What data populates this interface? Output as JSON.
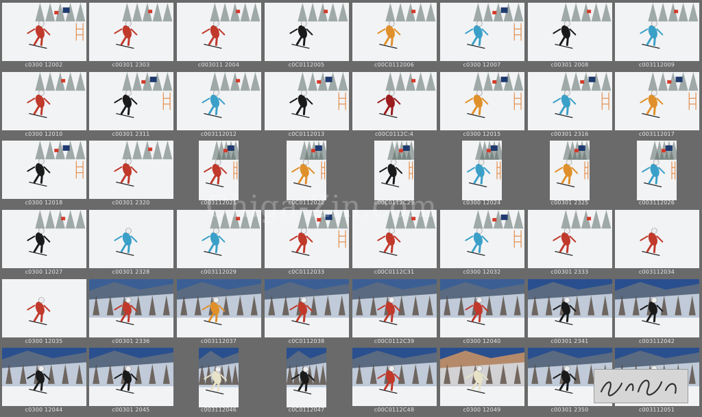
{
  "watermark": "Chiga-Zin.com",
  "signature": "Zin Shiga",
  "rows": [
    [
      {
        "caption": "c0300 12002",
        "scene": "snow-gates",
        "skier": "#c0392b"
      },
      {
        "caption": "c00301 2303",
        "scene": "snow-trees",
        "skier": "#c0392b"
      },
      {
        "caption": "c003011 2004",
        "scene": "snow-trees",
        "skier": "#c0392b"
      },
      {
        "caption": "c0C0112005",
        "scene": "snow-trees",
        "skier": "#1a1a1a"
      },
      {
        "caption": "c00C0112006",
        "scene": "snow-trees",
        "skier": "#e0902a"
      },
      {
        "caption": "c0300 12007",
        "scene": "snow-gates",
        "skier": "#3aa0c8"
      },
      {
        "caption": "c00301 2008",
        "scene": "snow-trees",
        "skier": "#1a1a1a"
      },
      {
        "caption": "c003112009",
        "scene": "snow-trees",
        "skier": "#3aa0c8"
      }
    ],
    [
      {
        "caption": "c0300 12010",
        "scene": "snow-trees",
        "skier": "#c0392b"
      },
      {
        "caption": "c00301 2311",
        "scene": "snow-gates",
        "skier": "#1a1a1a"
      },
      {
        "caption": "c003112012",
        "scene": "snow-trees",
        "skier": "#3aa0c8"
      },
      {
        "caption": "c0C0112013",
        "scene": "snow-gates",
        "skier": "#1a1a1a"
      },
      {
        "caption": "c00C0112C:4",
        "scene": "snow-trees",
        "skier": "#9b1d1d"
      },
      {
        "caption": "c0300 12015",
        "scene": "snow-gates",
        "skier": "#e0902a"
      },
      {
        "caption": "c00301 2316",
        "scene": "snow-gates",
        "skier": "#3aa0c8"
      },
      {
        "caption": "c003112017",
        "scene": "snow-gates",
        "skier": "#e0902a"
      }
    ],
    [
      {
        "caption": "c0300 12018",
        "scene": "snow-gates",
        "skier": "#1a1a1a"
      },
      {
        "caption": "c00301 2320",
        "scene": "snow-trees",
        "skier": "#c0392b"
      },
      {
        "caption": "c003112021",
        "scene": "snow-port",
        "skier": "#c0392b"
      },
      {
        "caption": "c0C0112022",
        "scene": "snow-port",
        "skier": "#e0902a"
      },
      {
        "caption": "c00C0112C23",
        "scene": "snow-port",
        "skier": "#1a1a1a"
      },
      {
        "caption": "c0300 12024",
        "scene": "snow-port",
        "skier": "#3aa0c8"
      },
      {
        "caption": "c00301 2325",
        "scene": "snow-port",
        "skier": "#e0902a"
      },
      {
        "caption": "c003112026",
        "scene": "snow-port",
        "skier": "#3aa0c8"
      }
    ],
    [
      {
        "caption": "c0300 12027",
        "scene": "snow-trees",
        "skier": "#1a1a1a"
      },
      {
        "caption": "c00301 2328",
        "scene": "snow-open",
        "skier": "#3aa0c8"
      },
      {
        "caption": "c003112029",
        "scene": "snow-trees",
        "skier": "#3aa0c8"
      },
      {
        "caption": "c0C0112033",
        "scene": "snow-gates",
        "skier": "#c0392b"
      },
      {
        "caption": "c00C0112C31",
        "scene": "snow-trees",
        "skier": "#c0392b"
      },
      {
        "caption": "c0300 12032",
        "scene": "snow-gates",
        "skier": "#3aa0c8"
      },
      {
        "caption": "c00301 2333",
        "scene": "snow-trees",
        "skier": "#c0392b"
      },
      {
        "caption": "c003112034",
        "scene": "snow-open",
        "skier": "#c0392b"
      }
    ],
    [
      {
        "caption": "c0300 12035",
        "scene": "snow-open",
        "skier": "#c0392b"
      },
      {
        "caption": "c00301 2336",
        "scene": "mountain",
        "skier": "#c0392b"
      },
      {
        "caption": "c003112037",
        "scene": "mountain",
        "skier": "#e0902a"
      },
      {
        "caption": "c0C0112038",
        "scene": "mountain",
        "skier": "#c0392b"
      },
      {
        "caption": "c00C0112C39",
        "scene": "mountain",
        "skier": "#c0392b"
      },
      {
        "caption": "c0300 12040",
        "scene": "mountain",
        "skier": "#c0392b"
      },
      {
        "caption": "c00301 2341",
        "scene": "mountain-blue",
        "skier": "#1a1a1a"
      },
      {
        "caption": "c003112042",
        "scene": "mountain-blue",
        "skier": "#1a1a1a"
      }
    ],
    [
      {
        "caption": "c0300 12044",
        "scene": "mountain-blue",
        "skier": "#1a1a1a"
      },
      {
        "caption": "c00301 2045",
        "scene": "mountain-blue",
        "skier": "#1a1a1a"
      },
      {
        "caption": "c003112046",
        "scene": "mountain-port",
        "skier": "#e8e2c8"
      },
      {
        "caption": "c0C0112047",
        "scene": "mountain-port",
        "skier": "#1a1a1a"
      },
      {
        "caption": "c00C0112C48",
        "scene": "mountain-blue",
        "skier": "#c0392b"
      },
      {
        "caption": "c0300 12049",
        "scene": "rock-trees",
        "skier": "#e8e2c8"
      },
      {
        "caption": "c00301 2350",
        "scene": "mountain-blue",
        "skier": "#1a1a1a"
      },
      {
        "caption": "c003112051",
        "scene": "mountain-blue",
        "skier": "#c0392b"
      }
    ]
  ],
  "colors": {
    "background": "#6a6a6a",
    "caption": "#e4e4e4",
    "snow": "#f2f3f5",
    "sky": "#2a4f8f"
  }
}
